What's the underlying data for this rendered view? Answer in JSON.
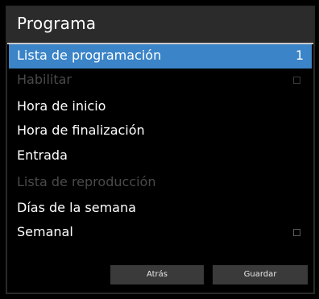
{
  "header": {
    "title": "Programa"
  },
  "menu": {
    "items": [
      {
        "label": "Lista de programación",
        "value": "1"
      },
      {
        "label": "Habilitar"
      },
      {
        "label": "Hora de inicio"
      },
      {
        "label": "Hora de finalización"
      },
      {
        "label": "Entrada"
      },
      {
        "label": "Lista de reproducción"
      },
      {
        "label": "Días de la semana"
      },
      {
        "label": "Semanal"
      }
    ]
  },
  "footer": {
    "back_label": "Atrás",
    "save_label": "Guardar"
  },
  "colors": {
    "selected_background": "#3b84c8",
    "disabled_text": "#4a4a4a",
    "button_background": "#3a3a3a"
  }
}
